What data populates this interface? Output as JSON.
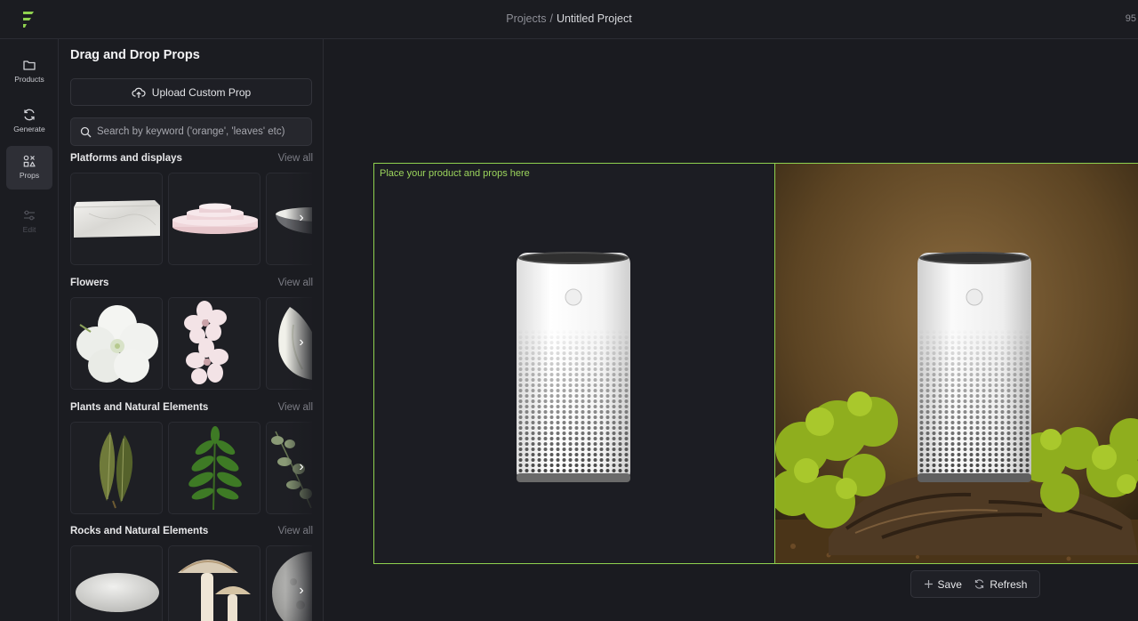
{
  "header": {
    "breadcrumb_root": "Projects",
    "breadcrumb_separator": "/",
    "breadcrumb_current": "Untitled Project",
    "right_text": "95"
  },
  "rail": {
    "items": [
      {
        "label": "Products",
        "icon": "folder-icon"
      },
      {
        "label": "Generate",
        "icon": "refresh-icon"
      },
      {
        "label": "Props",
        "icon": "props-icon",
        "active": true
      },
      {
        "label": "Edit",
        "icon": "sliders-icon",
        "disabled": true
      }
    ]
  },
  "panel": {
    "title": "Drag and Drop Props",
    "upload_label": "Upload Custom Prop",
    "search_placeholder": "Search by keyword ('orange', 'leaves' etc)",
    "view_all": "View all",
    "sections": [
      {
        "title": "Platforms and displays"
      },
      {
        "title": "Flowers"
      },
      {
        "title": "Plants and Natural Elements"
      },
      {
        "title": "Rocks and Natural Elements"
      }
    ]
  },
  "canvas": {
    "drop_hint": "Place your product and props here",
    "save_label": "Save",
    "refresh_label": "Refresh"
  },
  "colors": {
    "accent": "#8fd14f",
    "background": "#1a1b20",
    "panel": "#1b1c21"
  }
}
